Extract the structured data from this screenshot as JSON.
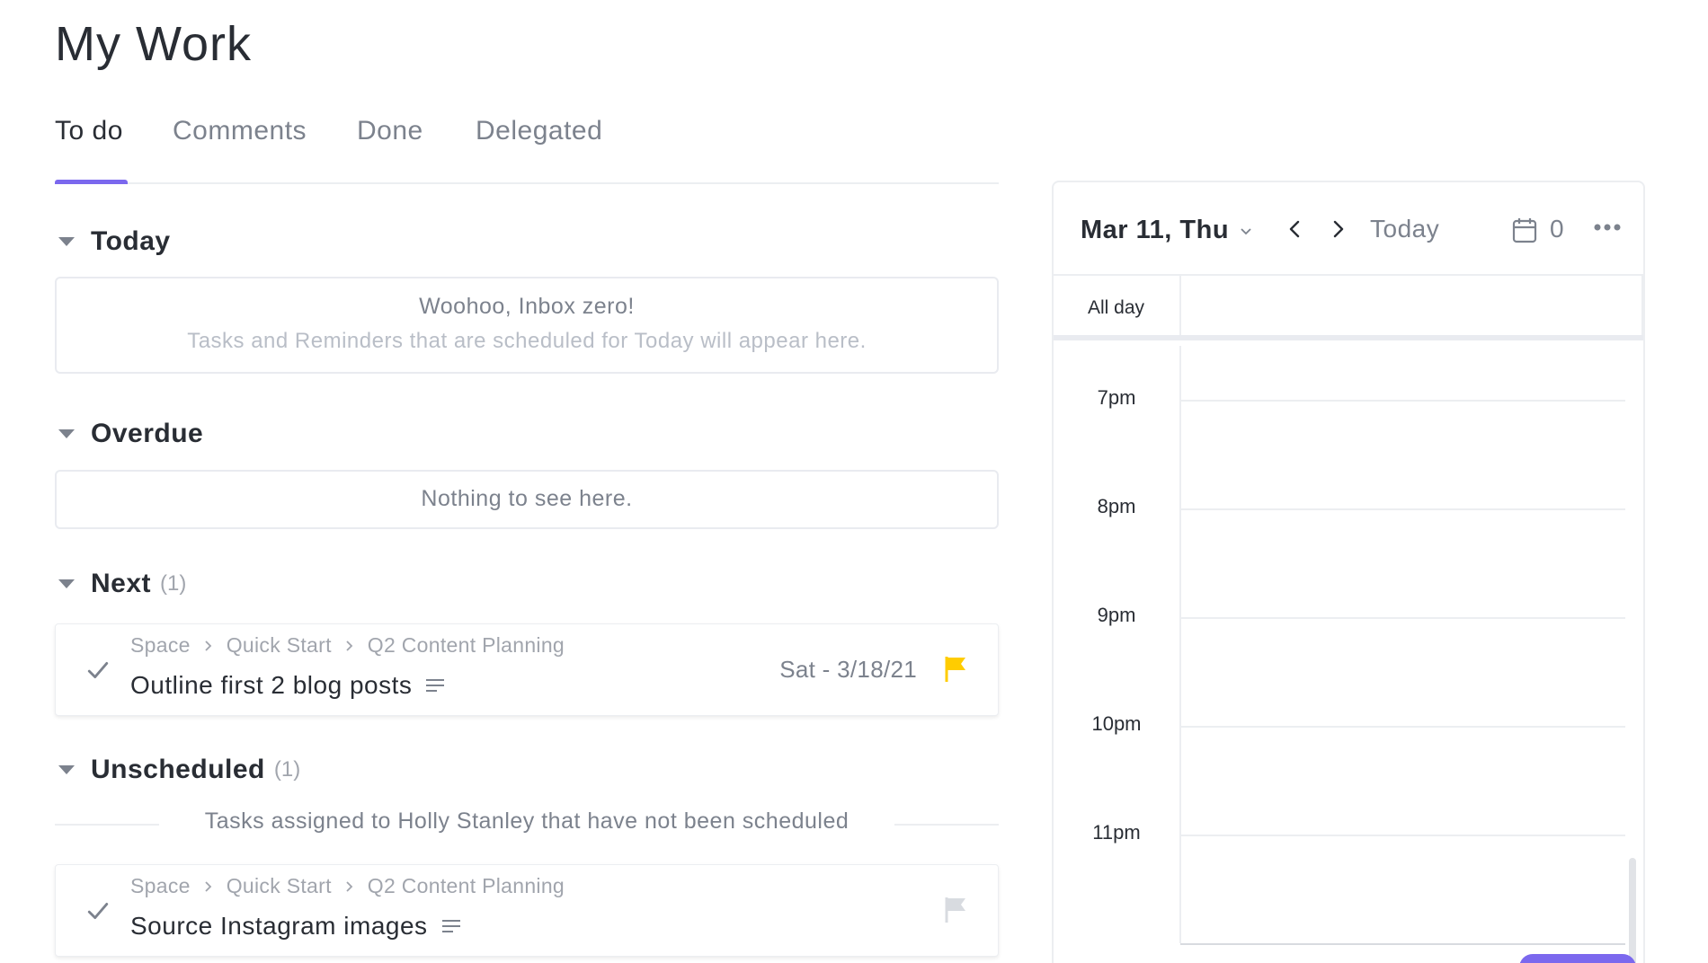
{
  "page": {
    "title": "My Work"
  },
  "tabs": [
    {
      "label": "To do",
      "active": true
    },
    {
      "label": "Comments",
      "active": false
    },
    {
      "label": "Done",
      "active": false
    },
    {
      "label": "Delegated",
      "active": false
    }
  ],
  "colors": {
    "accent": "#7b68ee",
    "flag_high": "#ffcc00",
    "flag_none": "#d8dbe0",
    "text": "#292d34",
    "muted": "#7c828d"
  },
  "sections": {
    "today": {
      "title": "Today",
      "empty_title": "Woohoo, Inbox zero!",
      "empty_subtitle": "Tasks and Reminders that are scheduled for Today will appear here."
    },
    "overdue": {
      "title": "Overdue",
      "empty_title": "Nothing to see here."
    },
    "next": {
      "title": "Next",
      "count": "(1)",
      "tasks": [
        {
          "breadcrumb": [
            "Space",
            "Quick Start",
            "Q2 Content Planning"
          ],
          "name": "Outline first 2 blog posts",
          "due": "Sat - 3/18/21",
          "flag": "flag-high-icon"
        }
      ]
    },
    "unscheduled": {
      "title": "Unscheduled",
      "count": "(1)",
      "divider_text": "Tasks assigned to Holly Stanley that have not been scheduled",
      "tasks": [
        {
          "breadcrumb": [
            "Space",
            "Quick Start",
            "Q2 Content Planning"
          ],
          "name": "Source Instagram images",
          "flag": "flag-empty-icon"
        }
      ]
    }
  },
  "calendar": {
    "date_label": "Mar 11, Thu",
    "today_label": "Today",
    "count": "0",
    "all_day_label": "All day",
    "hours": [
      "7pm",
      "8pm",
      "9pm",
      "10pm",
      "11pm"
    ]
  }
}
